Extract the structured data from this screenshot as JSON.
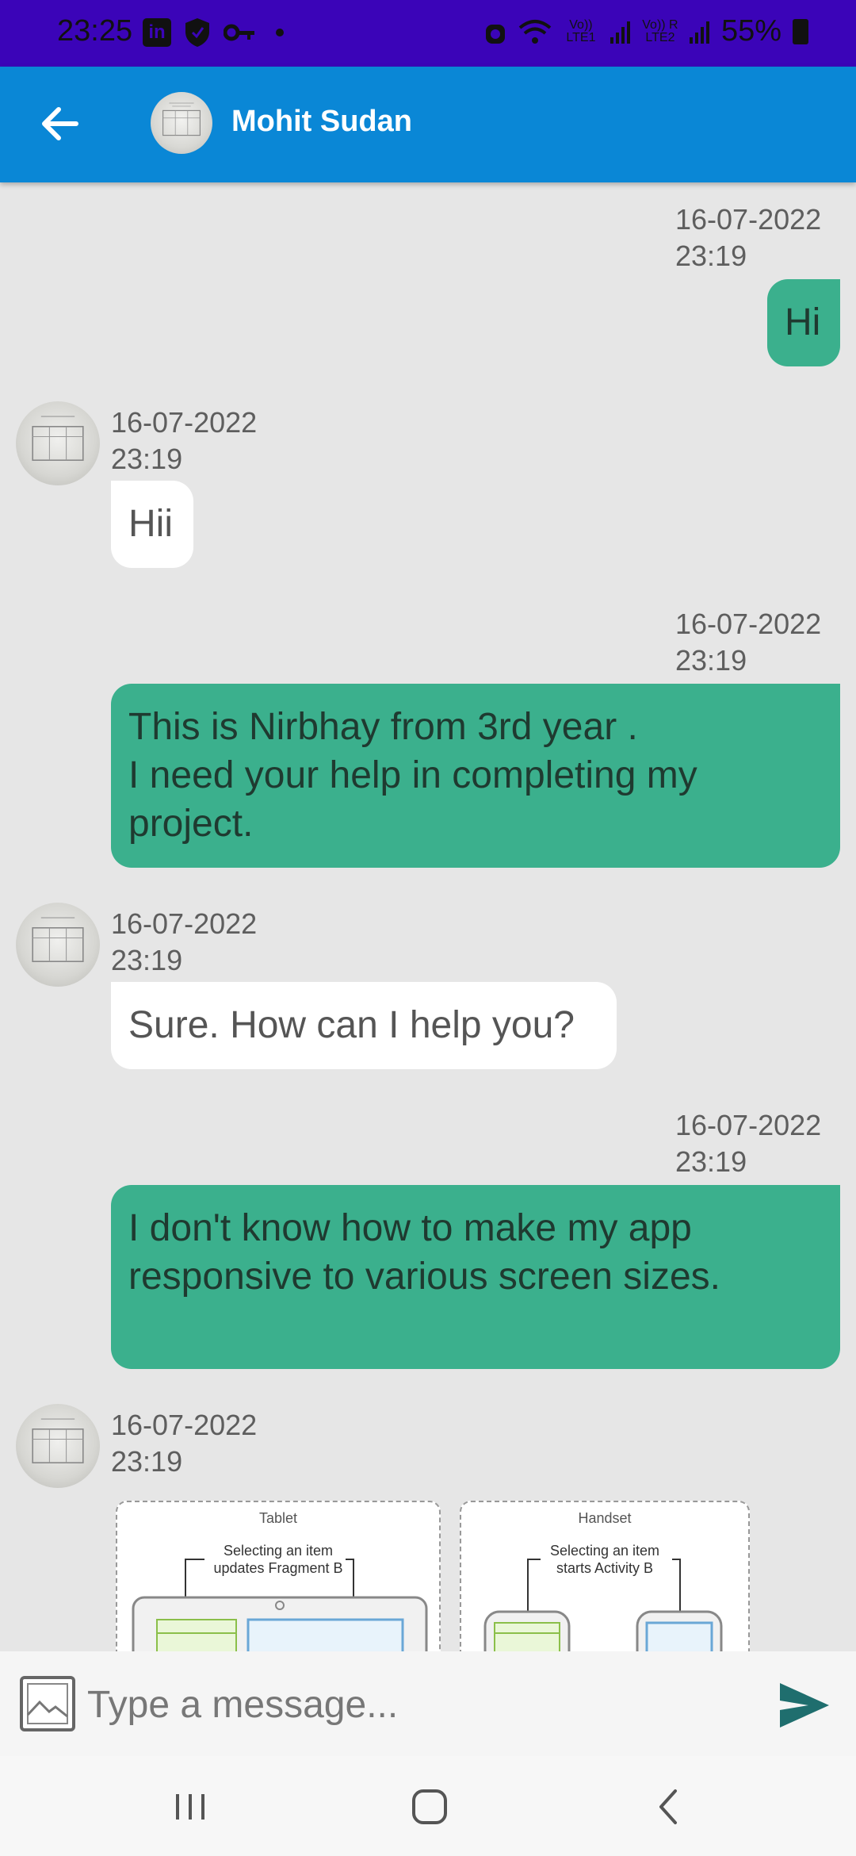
{
  "status_bar": {
    "time": "23:25",
    "left_icons": [
      "linkedin-icon",
      "shield-icon",
      "key-icon",
      "dot-icon"
    ],
    "sim1": "Vo)) LTE1",
    "sim2": "Vo)) R LTE2",
    "battery": "55%"
  },
  "header": {
    "back_icon": "arrow-left-icon",
    "contact_name": "Mohit Sudan"
  },
  "messages": [
    {
      "direction": "sent",
      "date": "16-07-2022",
      "time": "23:19",
      "text": "Hi"
    },
    {
      "direction": "received",
      "date": "16-07-2022",
      "time": "23:19",
      "text": "Hii"
    },
    {
      "direction": "sent",
      "date": "16-07-2022",
      "time": "23:19",
      "text": "This is Nirbhay from 3rd year .\nI need your help in completing my project."
    },
    {
      "direction": "received",
      "date": "16-07-2022",
      "time": "23:19",
      "text": "Sure. How can I help you?"
    },
    {
      "direction": "sent",
      "date": "16-07-2022",
      "time": "23:19",
      "text": "I don't know how to make my app responsive to various screen sizes."
    },
    {
      "direction": "received",
      "date": "16-07-2022",
      "time": "23:19",
      "image": {
        "panels": [
          {
            "title": "Tablet",
            "caption": "Selecting an item updates Fragment B"
          },
          {
            "title": "Handset",
            "caption": "Selecting an item starts Activity B"
          }
        ]
      }
    }
  ],
  "input": {
    "placeholder": "Type a message...",
    "attach_icon": "image-icon",
    "send_icon": "send-icon"
  },
  "nav": [
    "recents-icon",
    "home-icon",
    "back-icon"
  ],
  "colors": {
    "status_bar": "#3b04b8",
    "app_bar": "#0a87d6",
    "sent_bubble": "#3bb08d",
    "received_bubble": "#ffffff",
    "chat_background": "#e6e6e6",
    "send_icon": "#1f6e6e"
  }
}
